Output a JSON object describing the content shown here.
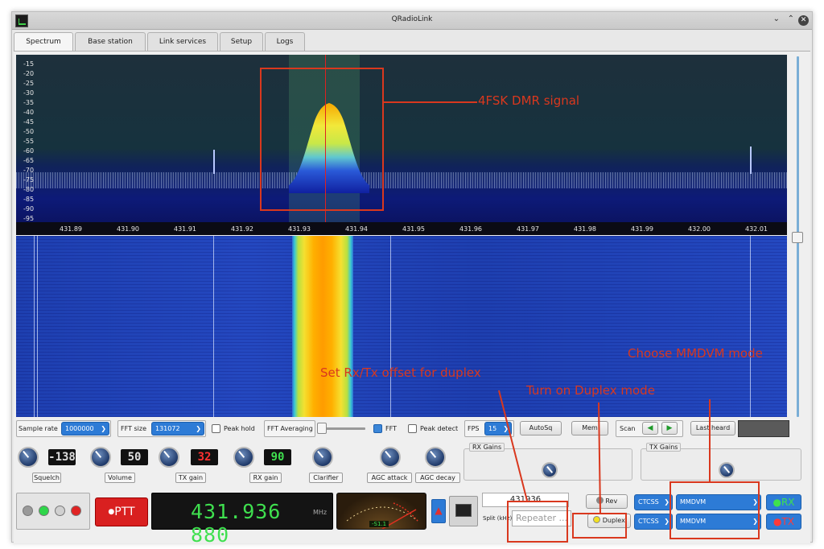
{
  "window": {
    "title": "QRadioLink"
  },
  "tabs": [
    "Spectrum",
    "Base station",
    "Link services",
    "Setup",
    "Logs"
  ],
  "spectrum": {
    "db_labels": [
      "-15",
      "-20",
      "-25",
      "-30",
      "-35",
      "-40",
      "-45",
      "-50",
      "-55",
      "-60",
      "-65",
      "-70",
      "-75",
      "-80",
      "-85",
      "-90",
      "-95"
    ],
    "freq_labels": [
      "431.89",
      "431.90",
      "431.91",
      "431.92",
      "431.93",
      "431.94",
      "431.95",
      "431.96",
      "431.97",
      "431.98",
      "431.99",
      "432.00",
      "432.01"
    ]
  },
  "controls": {
    "sample_rate_label": "Sample rate",
    "sample_rate_value": "1000000",
    "fft_size_label": "FFT size",
    "fft_size_value": "131072",
    "peak_hold_label": "Peak hold",
    "fft_avg_label": "FFT Averaging",
    "fft_label": "FFT",
    "peak_detect_label": "Peak detect",
    "fps_label": "FPS",
    "fps_value": "15",
    "autosq_label": "AutoSq",
    "mem_label": "Mem",
    "scan_label": "Scan",
    "last_heard_label": "Last heard"
  },
  "knobs": {
    "squelch_value": "-138",
    "squelch_label": "Squelch",
    "volume_value": "50",
    "volume_label": "Volume",
    "tx_gain_value": "32",
    "tx_gain_label": "TX gain",
    "rx_gain_value": "90",
    "rx_gain_label": "RX gain",
    "clarifier_label": "Clarifier",
    "agc_attack_label": "AGC attack",
    "agc_decay_label": "AGC decay",
    "rx_gains_label": "RX Gains",
    "tx_gains_label": "TX Gains"
  },
  "bottom": {
    "ptt_label": "PTT",
    "frequency": "431.936 880",
    "frequency_unit": "MHz",
    "smeter_readout": "-S1.1",
    "freq_entry": "431936",
    "split_label": "Split (kHz)",
    "repeater_placeholder": "Repeater ...",
    "rev_label": "Rev",
    "duplex_label": "Duplex",
    "ctcss_label_1": "CTCSS",
    "ctcss_label_2": "CTCSS",
    "mode_rx": "MMDVM",
    "mode_tx": "MMDVM",
    "rx_label": "RX",
    "tx_label": "TX"
  },
  "annotations": {
    "signal": "4FSK DMR signal",
    "mmdvm": "Choose MMDVM mode",
    "offset": "Set Rx/Tx offset for duplex",
    "duplex": "Turn on Duplex mode"
  },
  "colors": {
    "annotation": "#d9381e",
    "accent": "#2d7bd6",
    "led_green": "#2fd64a",
    "led_red": "#e02424"
  }
}
